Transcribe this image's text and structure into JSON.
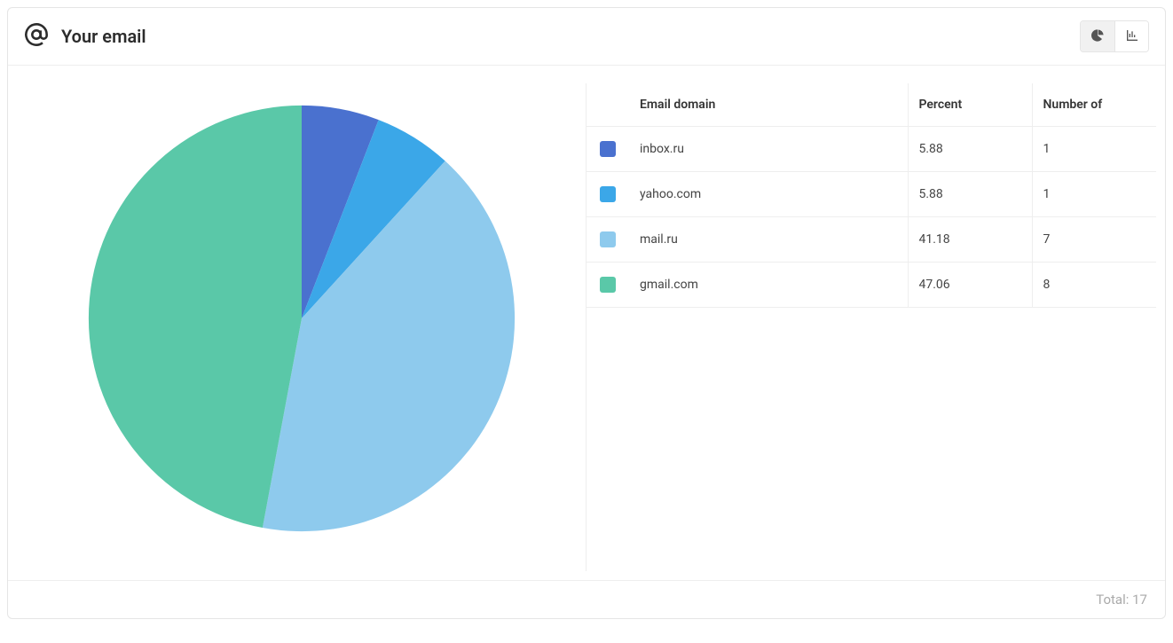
{
  "header": {
    "title": "Your email"
  },
  "table": {
    "headers": {
      "domain": "Email domain",
      "percent": "Percent",
      "number": "Number of"
    },
    "rows": [
      {
        "color": "#4A71CF",
        "domain": "inbox.ru",
        "percent": "5.88",
        "number": "1"
      },
      {
        "color": "#3BA7E8",
        "domain": "yahoo.com",
        "percent": "5.88",
        "number": "1"
      },
      {
        "color": "#8ECAED",
        "domain": "mail.ru",
        "percent": "41.18",
        "number": "7"
      },
      {
        "color": "#5AC8A8",
        "domain": "gmail.com",
        "percent": "47.06",
        "number": "8"
      }
    ]
  },
  "footer": {
    "total_label": "Total:",
    "total_value": "17"
  },
  "chart_data": {
    "type": "pie",
    "title": "Your email",
    "series": [
      {
        "name": "inbox.ru",
        "value": 5.88,
        "count": 1,
        "color": "#4A71CF"
      },
      {
        "name": "yahoo.com",
        "value": 5.88,
        "count": 1,
        "color": "#3BA7E8"
      },
      {
        "name": "mail.ru",
        "value": 41.18,
        "count": 7,
        "color": "#8ECAED"
      },
      {
        "name": "gmail.com",
        "value": 47.06,
        "count": 8,
        "color": "#5AC8A8"
      }
    ],
    "total": 17,
    "legend_position": "right",
    "start_angle_deg": 0
  }
}
